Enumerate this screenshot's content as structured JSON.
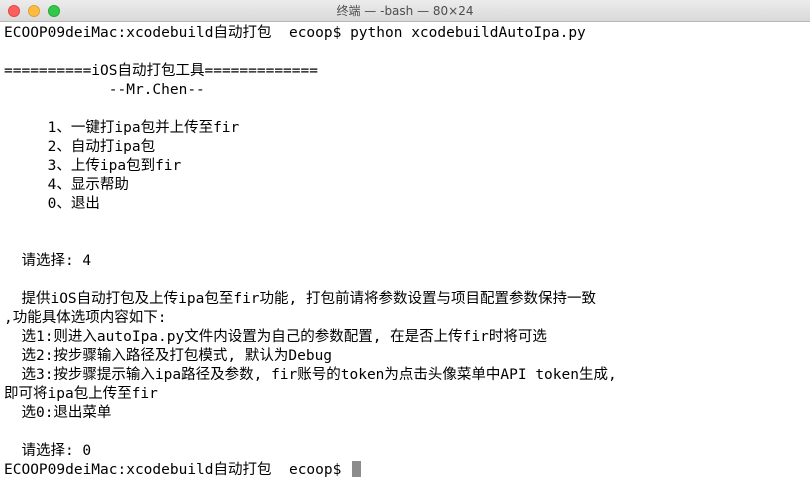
{
  "window": {
    "title": "终端 — -bash — 80×24"
  },
  "terminal": {
    "lines": [
      "ECOOP09deiMac:xcodebuild自动打包  ecoop$ python xcodebuildAutoIpa.py",
      "",
      "==========iOS自动打包工具=============",
      "            --Mr.Chen--",
      "",
      "     1、一键打ipa包并上传至fir",
      "     2、自动打ipa包",
      "     3、上传ipa包到fir",
      "     4、显示帮助",
      "     0、退出",
      "",
      "",
      "  请选择: 4",
      "",
      "  提供iOS自动打包及上传ipa包至fir功能, 打包前请将参数设置与项目配置参数保持一致",
      ",功能具体选项内容如下:",
      "  选1:则进入autoIpa.py文件内设置为自己的参数配置, 在是否上传fir时将可选",
      "  选2:按步骤输入路径及打包模式, 默认为Debug",
      "  选3:按步骤提示输入ipa路径及参数, fir账号的token为点击头像菜单中API token生成,",
      "即可将ipa包上传至fir",
      "  选0:退出菜单",
      "",
      "  请选择: 0",
      "ECOOP09deiMac:xcodebuild自动打包  ecoop$ "
    ]
  }
}
